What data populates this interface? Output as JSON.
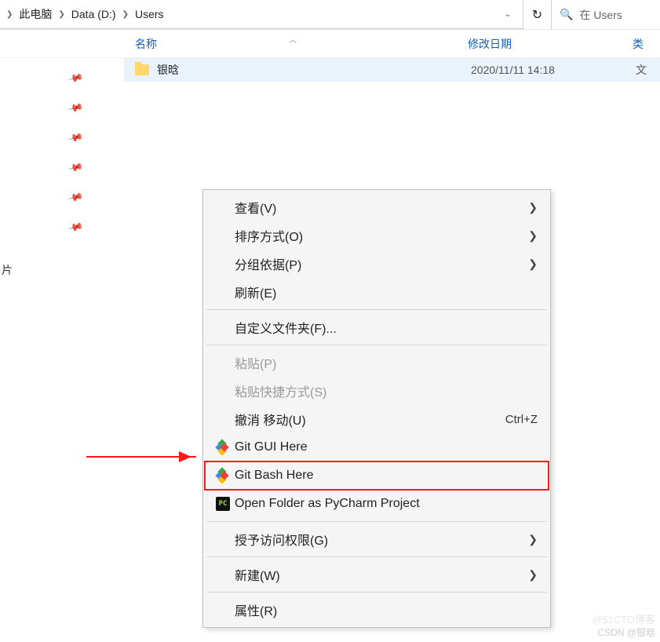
{
  "breadcrumb": {
    "items": [
      "此电脑",
      "Data (D:)",
      "Users"
    ]
  },
  "search": {
    "placeholder": "在 Users"
  },
  "columns": {
    "name": "名称",
    "modified": "修改日期",
    "type": "类"
  },
  "sidebar": {
    "label": "片"
  },
  "files": [
    {
      "name": "银晗",
      "modified": "2020/11/11 14:18",
      "type": "文"
    }
  ],
  "context_menu": {
    "view": "查看(V)",
    "sort": "排序方式(O)",
    "group": "分组依据(P)",
    "refresh": "刷新(E)",
    "customize": "自定义文件夹(F)...",
    "paste": "粘贴(P)",
    "paste_shortcut": "粘贴快捷方式(S)",
    "undo": "撤消 移动(U)",
    "undo_shortcut": "Ctrl+Z",
    "git_gui": "Git GUI Here",
    "git_bash": "Git Bash Here",
    "pycharm": "Open Folder as PyCharm Project",
    "grant_access": "授予访问权限(G)",
    "new": "新建(W)",
    "properties": "属性(R)"
  },
  "watermark": "CSDN @银晗",
  "watermark2": "@51CTO博客"
}
